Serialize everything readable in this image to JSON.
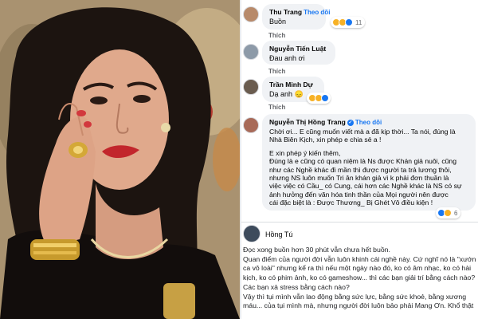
{
  "comments": [
    {
      "name": "Thu Trang",
      "follow": "Theo dõi",
      "text": [
        "Buồn"
      ],
      "like": "Thích",
      "reaction_count": "11"
    },
    {
      "name": "Nguyễn Tiến Luật",
      "follow": "",
      "text": [
        "Đau anh ơi"
      ],
      "like": "Thích",
      "reaction_count": ""
    },
    {
      "name": "Trần Minh Dự",
      "follow": "",
      "text": [
        "Dạ anh 😞"
      ],
      "like": "Thích",
      "reaction_count": ""
    },
    {
      "name": "Nguyễn Thị Hồng Trang",
      "follow": "Theo dõi",
      "text": [
        "Chời ơi... E cũng muốn viết mà a đã kịp thời... Ta nói, đúng là",
        "Nhà Biên Kịch, xin phép e chia sẻ a !",
        "",
        "E xin phép ý kiến thêm,",
        "Đúng là e cũng có quan niệm là Ns được Khán giả nuôi, cũng",
        "như các Nghề khác đi mần thì được người ta trả lương thôi,",
        "nhưng NS luôn muốn Tri ân khán giả vì k phải đơn thuần là",
        "việc việc có Cầu_ có Cung, cái hơn các Nghề khác là NS có sự",
        "ảnh hưởng đến văn hóa tinh thần của Mọi người nên được",
        "cái đặc biệt là : Được Thương_ Bị Ghét Vô điều kiện !"
      ],
      "like": "",
      "reaction_count": "6"
    }
  ],
  "post": {
    "author": "Hồng Tú",
    "lines": [
      "Đọc xong buồn hơn 30 phút vẫn chưa hết buồn.",
      "Quan điểm của người đời vẫn luôn khinh cái nghề này. Cứ nghĩ nó là \"xướng",
      "ca vô loài\" nhưng kể ra thì nếu một ngày nào đó, ko có âm nhạc, ko có hài",
      "kịch, ko có phim ảnh, ko có gameshow... thì các bạn giải trí bằng cách nào?",
      "Các bạn xả stress bằng cách nào?",
      "Vậy thì tụi mình vẫn lao động bằng sức lực, bằng sức khoẻ, bằng xương",
      "máu... của tụi mình mà, nhưng người đời luôn bảo phải Mang Ơn. Khổ thật"
    ]
  }
}
